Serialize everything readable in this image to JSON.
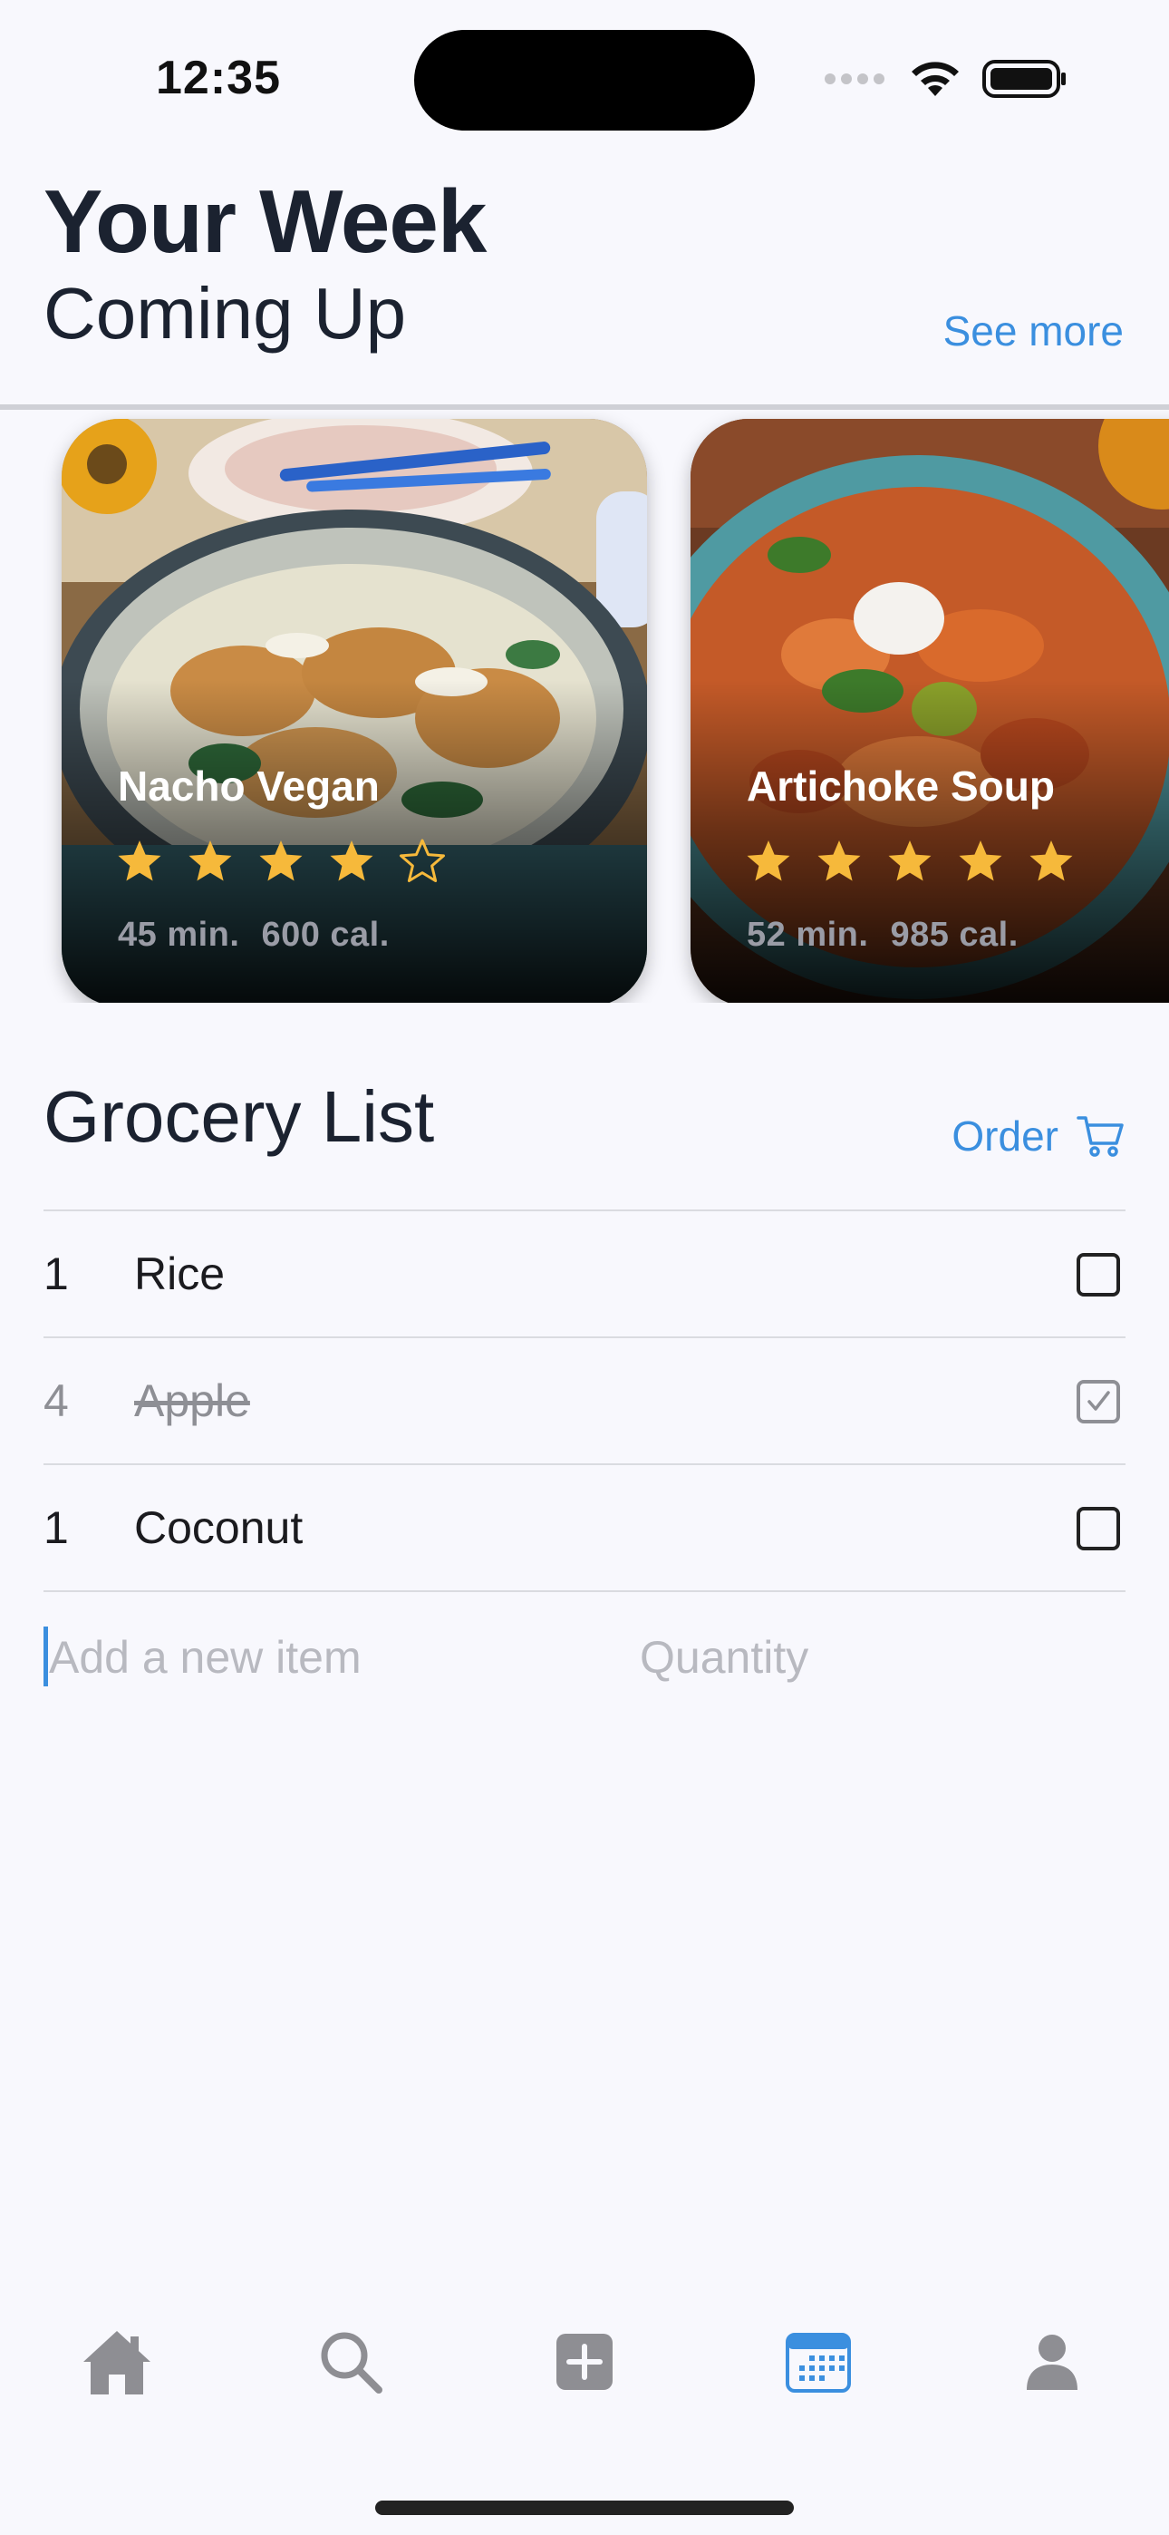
{
  "status": {
    "time": "12:35"
  },
  "header": {
    "title": "Your Week",
    "subtitle": "Coming Up",
    "see_more": "See more"
  },
  "cards": [
    {
      "title": "Nacho Vegan",
      "rating": 4,
      "max_rating": 5,
      "time": "45 min.",
      "calories": "600 cal."
    },
    {
      "title": "Artichoke Soup",
      "rating": 5,
      "max_rating": 5,
      "time": "52 min.",
      "calories": "985 cal."
    }
  ],
  "grocery": {
    "title": "Grocery List",
    "order_label": "Order",
    "items": [
      {
        "qty": "1",
        "name": "Rice",
        "checked": false
      },
      {
        "qty": "4",
        "name": "Apple",
        "checked": true
      },
      {
        "qty": "1",
        "name": "Coconut",
        "checked": false
      }
    ],
    "new_item_placeholder": "Add a new item",
    "quantity_placeholder": "Quantity"
  },
  "tabbar": {
    "items": [
      {
        "icon": "home-icon",
        "active": false
      },
      {
        "icon": "search-icon",
        "active": false
      },
      {
        "icon": "plus-square-icon",
        "active": false
      },
      {
        "icon": "calendar-icon",
        "active": true
      },
      {
        "icon": "person-icon",
        "active": false
      }
    ]
  },
  "colors": {
    "accent": "#3b8fdf",
    "star": "#f6b93b",
    "inactive_tab": "#8e8e93",
    "background": "#f8f8fd"
  }
}
